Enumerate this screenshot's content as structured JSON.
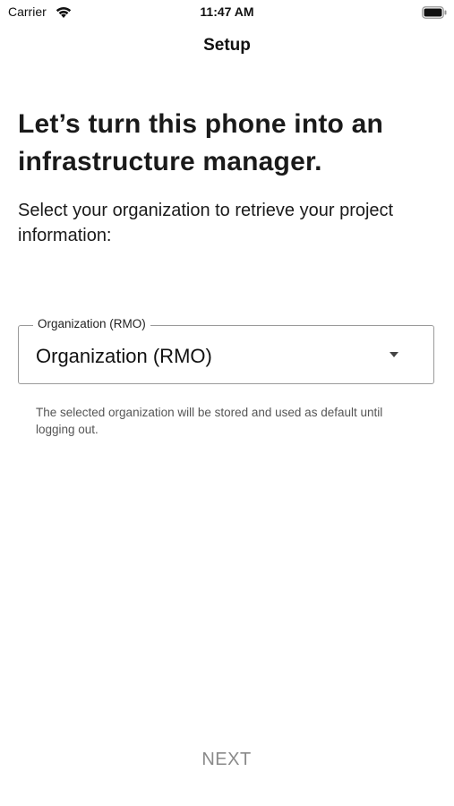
{
  "status_bar": {
    "carrier": "Carrier",
    "time": "11:47 AM",
    "wifi_icon": "wifi-icon",
    "battery_icon": "battery-icon"
  },
  "nav": {
    "title": "Setup"
  },
  "content": {
    "headline": "Let’s turn this phone into an infrastructure manager.",
    "subtext": "Select your organization to retrieve your project information:"
  },
  "organization_select": {
    "label": "Organization (RMO)",
    "value": "Organization (RMO)",
    "arrow_icon": "dropdown-arrow-icon",
    "helper": "The selected organization will be stored and used as default until logging out."
  },
  "footer": {
    "next_label": "NEXT"
  },
  "colors": {
    "text": "#111111",
    "helper": "#555555",
    "disabled_button": "#8a8a8a",
    "outline": "#9a9a9a"
  }
}
